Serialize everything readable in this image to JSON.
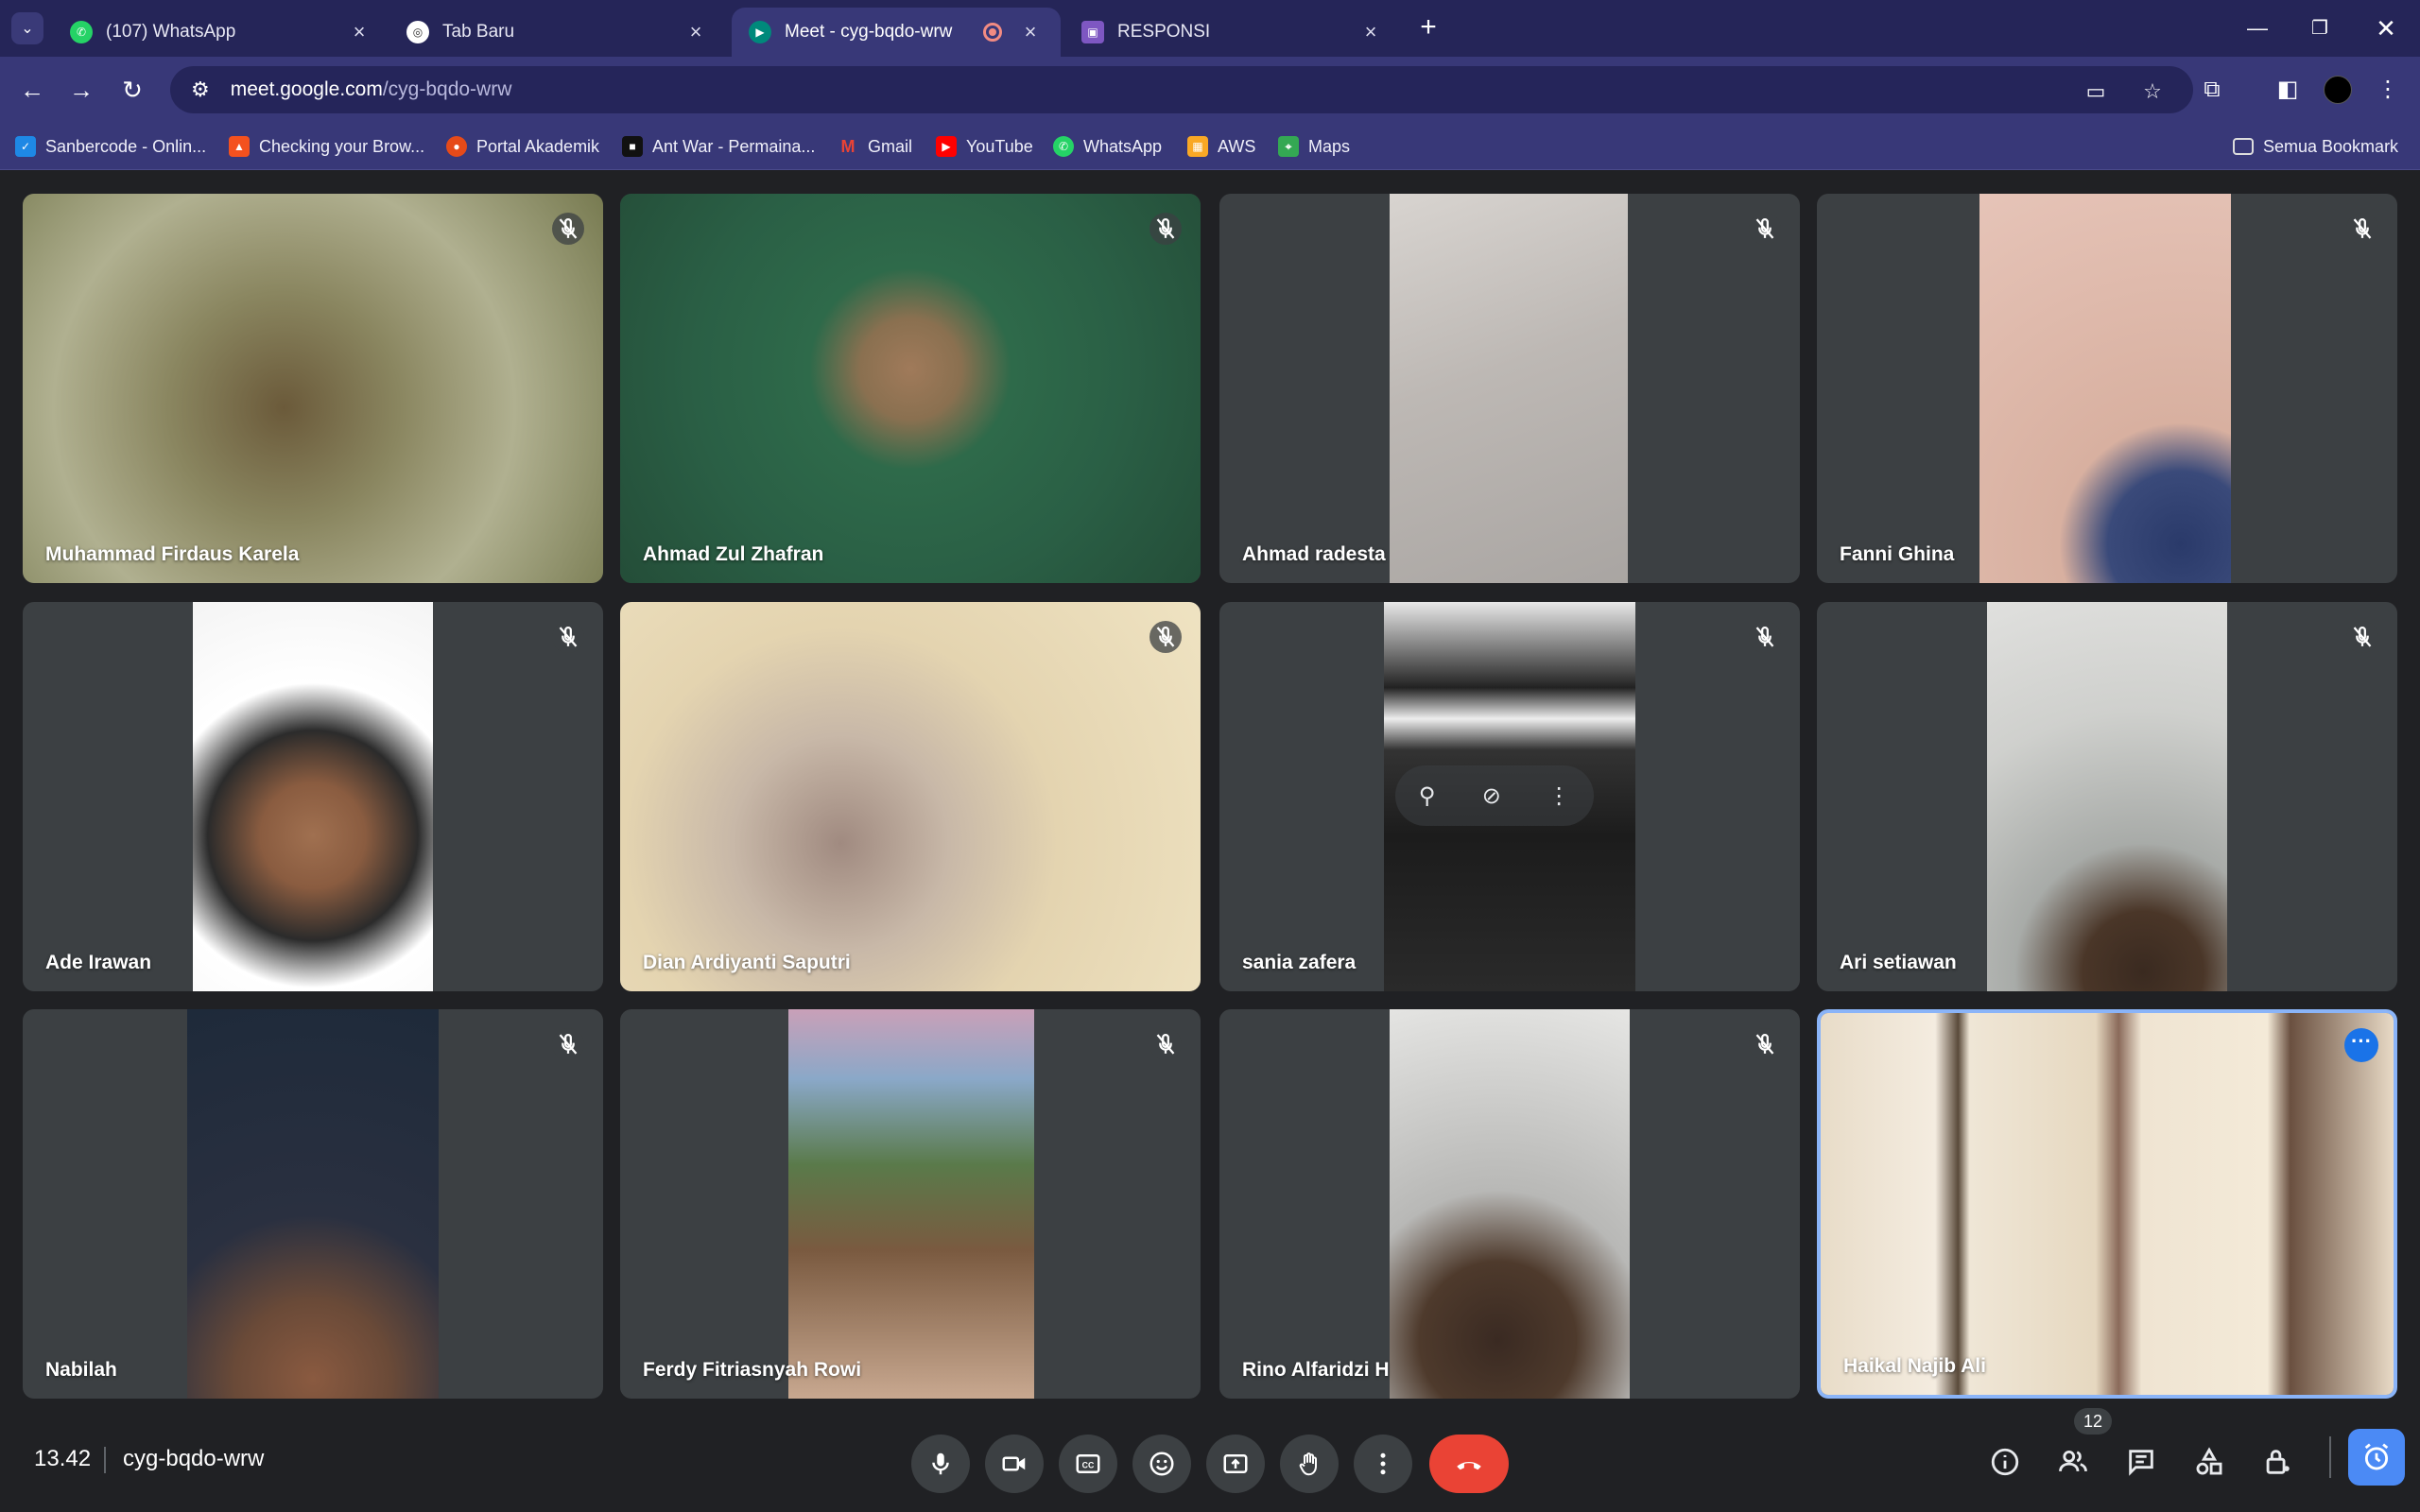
{
  "browser": {
    "tabs": [
      {
        "title": "(107) WhatsApp",
        "favicon": "whatsapp-icon",
        "color": "#25d366"
      },
      {
        "title": "Tab Baru",
        "favicon": "chrome-icon",
        "color": "#ffffff"
      },
      {
        "title": "Meet - cyg-bqdo-wrw",
        "favicon": "meet-icon",
        "color": "#00897b",
        "active": true,
        "recording": true
      },
      {
        "title": "RESPONSI",
        "favicon": "form-icon",
        "color": "#7e57c2"
      }
    ],
    "url_host": "meet.google.com",
    "url_path": "/cyg-bqdo-wrw",
    "bookmarks": [
      {
        "label": "Sanbercode - Onlin...",
        "color": "#1e88e5"
      },
      {
        "label": "Checking your Brow...",
        "color": "#f4511e"
      },
      {
        "label": "Portal Akademik",
        "color": "#e64a19"
      },
      {
        "label": "Ant War - Permaina...",
        "color": "#111111"
      },
      {
        "label": "Gmail",
        "color": "#ea4335"
      },
      {
        "label": "YouTube",
        "color": "#ff0000"
      },
      {
        "label": "WhatsApp",
        "color": "#25d366"
      },
      {
        "label": "AWS",
        "color": "#f9a825"
      },
      {
        "label": "Maps",
        "color": "#34a853"
      }
    ],
    "all_bookmarks": "Semua Bookmark"
  },
  "participants": [
    {
      "name": "Muhammad Firdaus Karela",
      "muted": true
    },
    {
      "name": "Ahmad Zul Zhafran",
      "muted": true
    },
    {
      "name": "Ahmad radesta",
      "muted": true
    },
    {
      "name": "Fanni Ghina",
      "muted": true
    },
    {
      "name": "Ade Irawan",
      "muted": true
    },
    {
      "name": "Dian Ardiyanti Saputri",
      "muted": true
    },
    {
      "name": "sania zafera",
      "muted": true
    },
    {
      "name": "Ari setiawan",
      "muted": true
    },
    {
      "name": "Nabilah",
      "muted": true
    },
    {
      "name": "Ferdy Fitriasnyah Rowi",
      "muted": true
    },
    {
      "name": "Rino Alfaridzi H",
      "muted": true
    },
    {
      "name": "Haikal Najib Ali",
      "muted": false,
      "speaking": true
    }
  ],
  "meeting": {
    "time": "13.42",
    "code": "cyg-bqdo-wrw",
    "participant_count": "12"
  },
  "colors": {
    "chrome_dark": "#252558",
    "chrome": "#383878",
    "meet_bg": "#202124",
    "tile_bg": "#3c4043",
    "hangup": "#ea4335",
    "active_border": "#8ab4f8"
  }
}
